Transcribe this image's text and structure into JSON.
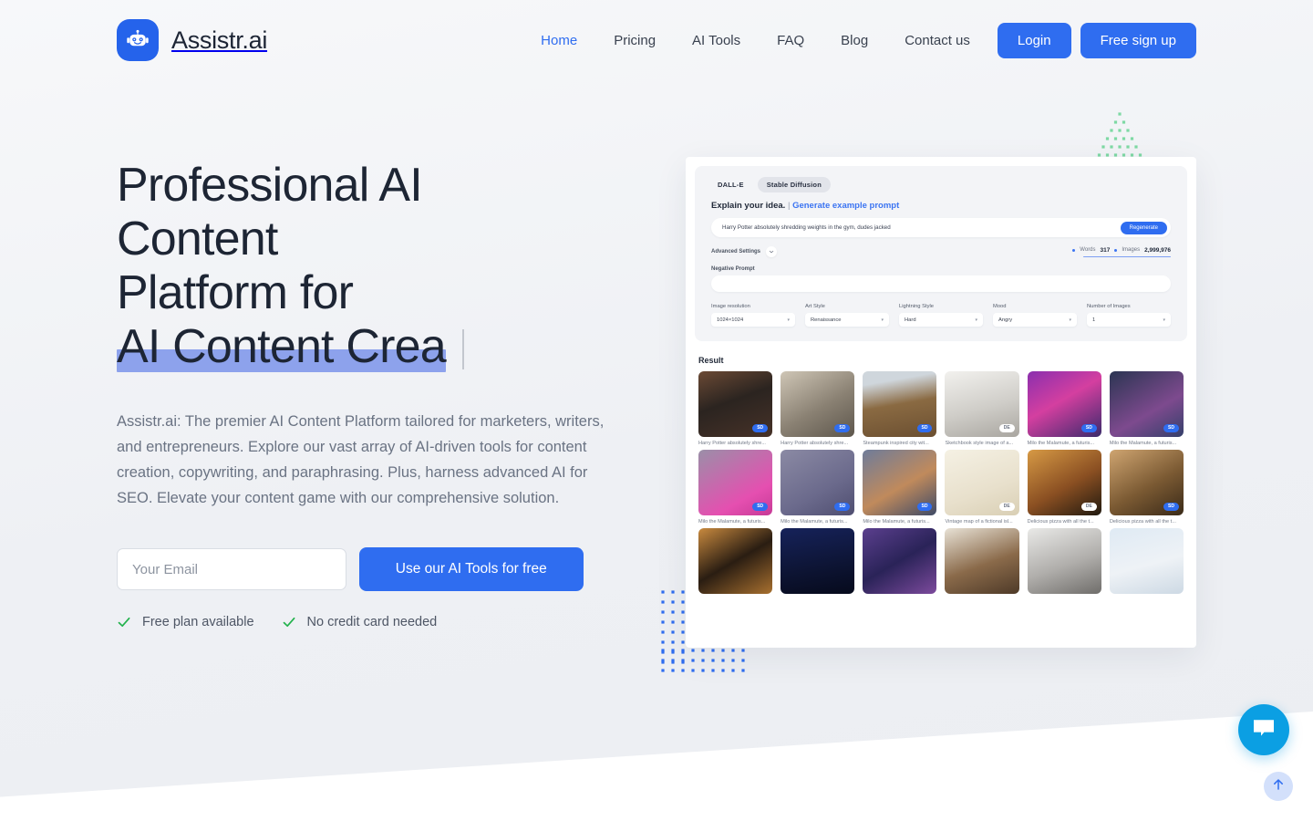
{
  "brand": {
    "name": "Assistr.ai",
    "logo_icon": "robot-icon",
    "color": "#2563eb"
  },
  "nav": {
    "links": [
      {
        "label": "Home",
        "active": true
      },
      {
        "label": "Pricing",
        "active": false
      },
      {
        "label": "AI Tools",
        "active": false
      },
      {
        "label": "FAQ",
        "active": false
      },
      {
        "label": "Blog",
        "active": false
      },
      {
        "label": "Contact us",
        "active": false
      }
    ],
    "login_label": "Login",
    "signup_label": "Free sign up",
    "accent_color": "#2f6df0",
    "active_color": "#2f6df0"
  },
  "hero": {
    "title_line1": "Professional AI Content",
    "title_line2": "Platform for",
    "title_typed": "AI Content Crea",
    "highlight_color": "#8da2ec",
    "subtitle": "Assistr.ai: The premier AI Content Platform tailored for marketers, writers, and entrepreneurs. Explore our vast array of AI-driven tools for content creation, copywriting, and paraphrasing. Plus, harness advanced AI for SEO. Elevate your content game with our comprehensive solution.",
    "email_placeholder": "Your Email",
    "email_value": "",
    "cta_label": "Use our AI Tools for free",
    "perks": [
      {
        "label": "Free plan available",
        "icon": "check-icon"
      },
      {
        "label": "No credit card needed",
        "icon": "check-icon"
      }
    ],
    "perk_check_color": "#22b24c"
  },
  "app_mock": {
    "engines": [
      {
        "label": "DALL-E",
        "selected": false
      },
      {
        "label": "Stable Diffusion",
        "selected": true
      }
    ],
    "explain_label": "Explain your idea.",
    "explain_divider": "|",
    "generate_link": "Generate example prompt",
    "prompt_value": "Harry Potter absolutely shredding weights in the gym, dudes jacked",
    "regenerate_label": "Regenerate",
    "advanced_settings_label": "Advanced Settings",
    "advanced_toggle_icon": "chevron-down-icon",
    "stats": [
      {
        "key": "Words",
        "value": "317"
      },
      {
        "key": "Images",
        "value": "2,999,976"
      }
    ],
    "negative_prompt_label": "Negative Prompt",
    "negative_prompt_value": "",
    "selects": [
      {
        "label": "Image resolution",
        "value": "1024×1024"
      },
      {
        "label": "Art Style",
        "value": "Renaissance"
      },
      {
        "label": "Lightning Style",
        "value": "Hard"
      },
      {
        "label": "Mood",
        "value": "Angry"
      },
      {
        "label": "Number of Images",
        "value": "1"
      }
    ],
    "result_label": "Result",
    "results": [
      {
        "caption": "Harry Potter absolutely shre...",
        "badge": "SD",
        "art": "gym-man"
      },
      {
        "caption": "Harry Potter absolutely shre...",
        "badge": "SD",
        "art": "gym-bw"
      },
      {
        "caption": "Steampunk inspired city wit...",
        "badge": "SD",
        "art": "steampunk"
      },
      {
        "caption": "Sketchbook style image of a...",
        "badge": "DE",
        "art": "snow-sketch"
      },
      {
        "caption": "Milo the Malamute, a futuris...",
        "badge": "SD",
        "art": "dog-neon"
      },
      {
        "caption": "Milo the Malamute, a futuris...",
        "badge": "SD",
        "art": "dog-dark"
      },
      {
        "caption": "Milo the Malamute, a futuris...",
        "badge": "SD",
        "art": "dog-pink"
      },
      {
        "caption": "Milo the Malamute, a futuris...",
        "badge": "SD",
        "art": "dog-violet"
      },
      {
        "caption": "Milo the Malamute, a futuris...",
        "badge": "SD",
        "art": "dog-city"
      },
      {
        "caption": "Vintage map of a fictional isl...",
        "badge": "DE",
        "art": "map"
      },
      {
        "caption": "Delicious pizza with all the t...",
        "badge": "DE",
        "art": "pizza"
      },
      {
        "caption": "Delicious pizza with all the t...",
        "badge": "SD",
        "art": "pizza-gear"
      },
      {
        "caption": "",
        "badge": "",
        "art": "pizza-pattern"
      },
      {
        "caption": "",
        "badge": "",
        "art": "moon-couple"
      },
      {
        "caption": "",
        "badge": "",
        "art": "collage"
      },
      {
        "caption": "",
        "badge": "",
        "art": "snow-house"
      },
      {
        "caption": "",
        "badge": "",
        "art": "snow-bw"
      },
      {
        "caption": "",
        "badge": "",
        "art": "birds"
      }
    ]
  },
  "decor": {
    "green_dots_color": "#7ed9a4",
    "blue_dots_color": "#2f6df0"
  },
  "widgets": {
    "chat_icon": "chat-bubble-icon",
    "chat_color": "#0b9fe3",
    "scroll_top_icon": "arrow-up-icon",
    "scroll_top_color": "#d3e0fb"
  }
}
